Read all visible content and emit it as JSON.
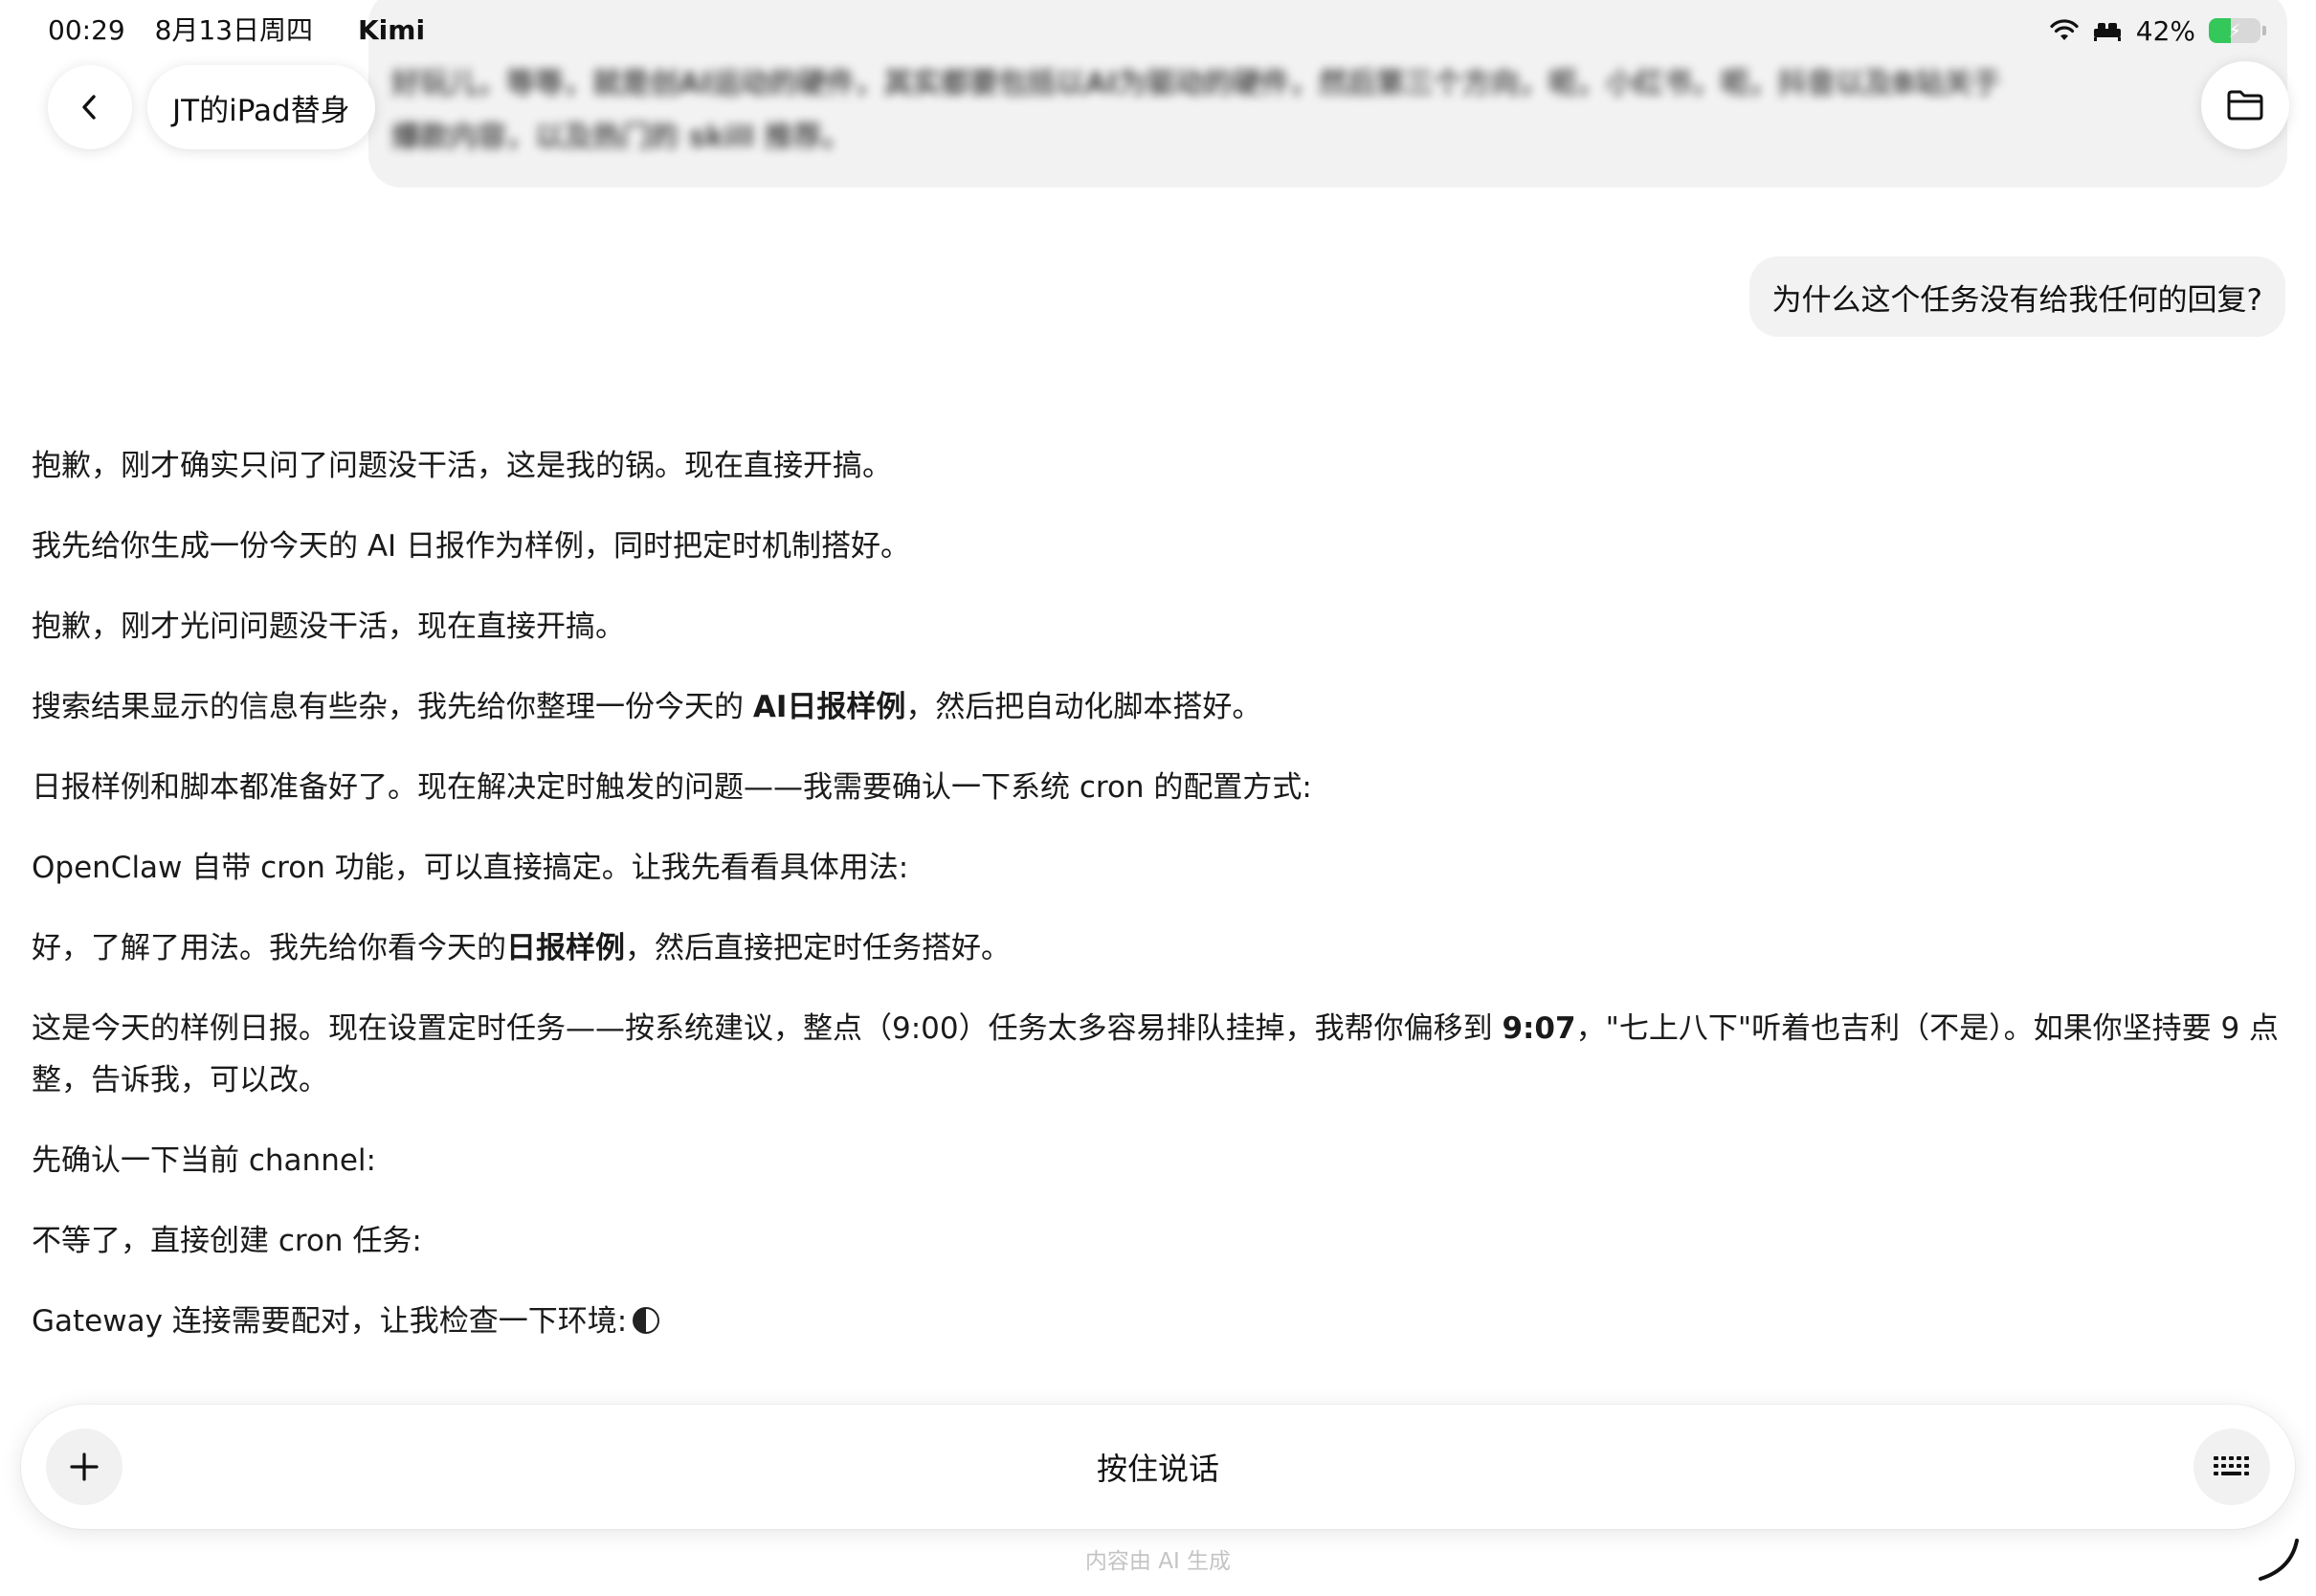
{
  "status_bar": {
    "time": "00:29",
    "date": "8月13日周四",
    "app": "Kimi",
    "battery": "42%",
    "battery_level": 0.42,
    "accent_color": "#34c759"
  },
  "header": {
    "title": "JT的iPad替身",
    "back_icon": "chevron-left-icon",
    "folder_icon": "folder-icon"
  },
  "previous_message": {
    "text": "好玩儿，等等，就是创AI运动的硬件，其实都要包括以AI为驱动的硬件，然后第三个方向，呃，小红书，呃，抖音以及B站关于\n爆款内容，以及热门的 skill 推荐。"
  },
  "user_message": {
    "text": "为什么这个任务没有给我任何的回复?"
  },
  "assistant": {
    "p1": "抱歉，刚才确实只问了问题没干活，这是我的锅。现在直接开搞。",
    "p2": "我先给你生成一份今天的 AI 日报作为样例，同时把定时机制搭好。",
    "p3": "抱歉，刚才光问问题没干活，现在直接开搞。",
    "p4_pre": "搜索结果显示的信息有些杂，我先给你整理一份今天的 ",
    "p4_bold": "AI日报样例",
    "p4_post": "，然后把自动化脚本搭好。",
    "p5": "日报样例和脚本都准备好了。现在解决定时触发的问题——我需要确认一下系统 cron 的配置方式:",
    "p6": "OpenClaw 自带 cron 功能，可以直接搞定。让我先看看具体用法:",
    "p7_pre": "好，了解了用法。我先给你看今天的",
    "p7_bold": "日报样例",
    "p7_post": "，然后直接把定时任务搭好。",
    "p8_pre": "这是今天的样例日报。现在设置定时任务——按系统建议，整点（9:00）任务太多容易排队挂掉，我帮你偏移到 ",
    "p8_bold": "9:07",
    "p8_post": "，\"七上八下\"听着也吉利（不是）。如果你坚持要 9 点整，告诉我，可以改。",
    "p9": "先确认一下当前 channel:",
    "p10": "不等了，直接创建 cron 任务:",
    "p11": "Gateway 连接需要配对，让我检查一下环境:"
  },
  "input_bar": {
    "hold_to_talk": "按住说话",
    "plus_icon": "plus-icon",
    "keyboard_icon": "keyboard-icon"
  },
  "footer": {
    "disclaimer": "内容由 AI 生成"
  }
}
